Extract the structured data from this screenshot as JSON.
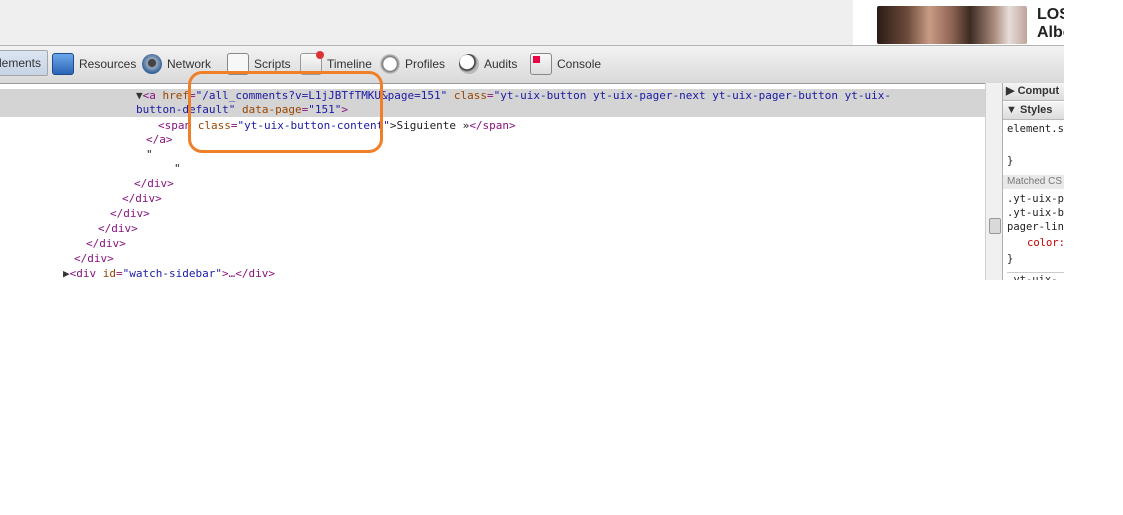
{
  "page": {
    "video_title_line1": "LOS",
    "video_title_line2": "Albo"
  },
  "toolbar": {
    "tabs": [
      {
        "label": "lements",
        "icon": "elements-icon"
      },
      {
        "label": "Resources",
        "icon": "resources-icon"
      },
      {
        "label": "Network",
        "icon": "network-icon"
      },
      {
        "label": "Scripts",
        "icon": "scripts-icon"
      },
      {
        "label": "Timeline",
        "icon": "timeline-icon"
      },
      {
        "label": "Profiles",
        "icon": "profiles-icon"
      },
      {
        "label": "Audits",
        "icon": "audits-icon"
      },
      {
        "label": "Console",
        "icon": "console-icon"
      }
    ]
  },
  "dom": {
    "a_open_tag": "<a",
    "href_attr": "href",
    "href_value": "\"/all_comments?v=L1jJBTfTMKU&page=151\"",
    "class_attr": "class",
    "class_value_1": "\"yt-uix-button yt-uix-pager-next yt-uix-pager-button yt-uix-",
    "class_value_2": "button-default\"",
    "datapage_attr": "data-page",
    "datapage_value": "\"151\"",
    "close_bracket": ">",
    "span_open": "<span",
    "span_class_attr": "class",
    "span_class_value": "\"yt-uix-button-content\"",
    "span_text": ">Siguiente »",
    "span_close": "</span>",
    "a_close": "</a>",
    "quote_line_1": "\"",
    "quote_line_2": "\"",
    "div_close": "</div>",
    "sidebar_div_open": "<div",
    "sidebar_id_attr": "id",
    "sidebar_id_value": "\"watch-sidebar\"",
    "sidebar_div_rest": ">…</div>"
  },
  "sidebar": {
    "computed_label": "Comput",
    "styles_label": "Styles",
    "element_style": "element.s",
    "close_brace": "}",
    "matched_label": "Matched CS",
    "rule_line_1": ".yt-uix-p",
    "rule_line_2": ".yt-uix-b",
    "rule_line_3": "pager-lin",
    "rule_prop": "color:",
    "rule_close": "}",
    "rule_next": ".yt-uix-"
  }
}
